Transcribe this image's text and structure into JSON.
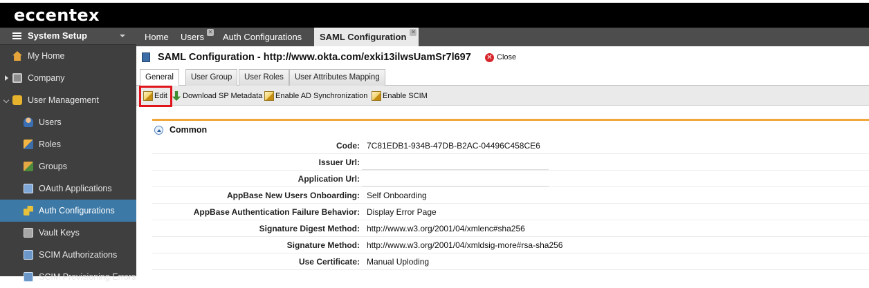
{
  "brand": "eccentex",
  "sidebar": {
    "header": "System Setup",
    "items": [
      {
        "label": "My Home",
        "icon": "home-icon"
      },
      {
        "label": "Company",
        "icon": "company-icon"
      },
      {
        "label": "User Management",
        "icon": "lock-icon"
      },
      {
        "label": "Users",
        "icon": "user-icon"
      },
      {
        "label": "Roles",
        "icon": "roles-icon"
      },
      {
        "label": "Groups",
        "icon": "groups-icon"
      },
      {
        "label": "OAuth Applications",
        "icon": "oauth-icon"
      },
      {
        "label": "Auth Configurations",
        "icon": "key-icon",
        "active": true
      },
      {
        "label": "Vault Keys",
        "icon": "vault-icon"
      },
      {
        "label": "SCIM Authorizations",
        "icon": "scim-icon"
      },
      {
        "label": "SCIM Provisioning Errors",
        "icon": "scim-icon"
      }
    ]
  },
  "tabs": [
    {
      "label": "Home"
    },
    {
      "label": "Users"
    },
    {
      "label": "Auth Configurations"
    },
    {
      "label": "SAML Configuration",
      "active": true
    }
  ],
  "page": {
    "title": "SAML Configuration - http://www.okta.com/exki13ilwsUamSr7l697",
    "close_label": "Close"
  },
  "subtabs": [
    {
      "label": "General",
      "active": true
    },
    {
      "label": "User Group"
    },
    {
      "label": "User Roles"
    },
    {
      "label": "User Attributes Mapping"
    }
  ],
  "toolbar": {
    "edit": "Edit",
    "download": "Download SP Metadata",
    "enable_ad": "Enable AD Synchronization",
    "enable_scim": "Enable SCIM"
  },
  "section": {
    "title": "Common",
    "fields": [
      {
        "label": "Code:",
        "value": "7C81EDB1-934B-47DB-B2AC-04496C458CE6"
      },
      {
        "label": "Issuer Url:",
        "value": ""
      },
      {
        "label": "Application Url:",
        "value": ""
      },
      {
        "label": "AppBase New Users Onboarding:",
        "value": "Self Onboarding"
      },
      {
        "label": "AppBase Authentication Failure Behavior:",
        "value": "Display Error Page"
      },
      {
        "label": "Signature Digest Method:",
        "value": "http://www.w3.org/2001/04/xmlenc#sha256"
      },
      {
        "label": "Signature Method:",
        "value": "http://www.w3.org/2001/04/xmldsig-more#rsa-sha256"
      },
      {
        "label": "Use Certificate:",
        "value": "Manual Uploding"
      }
    ]
  },
  "colors": {
    "sidebar_bg": "#3f3f3f",
    "active_item": "#3d79a6",
    "accent_line": "#f2a73a",
    "highlight": "#e1141c"
  }
}
